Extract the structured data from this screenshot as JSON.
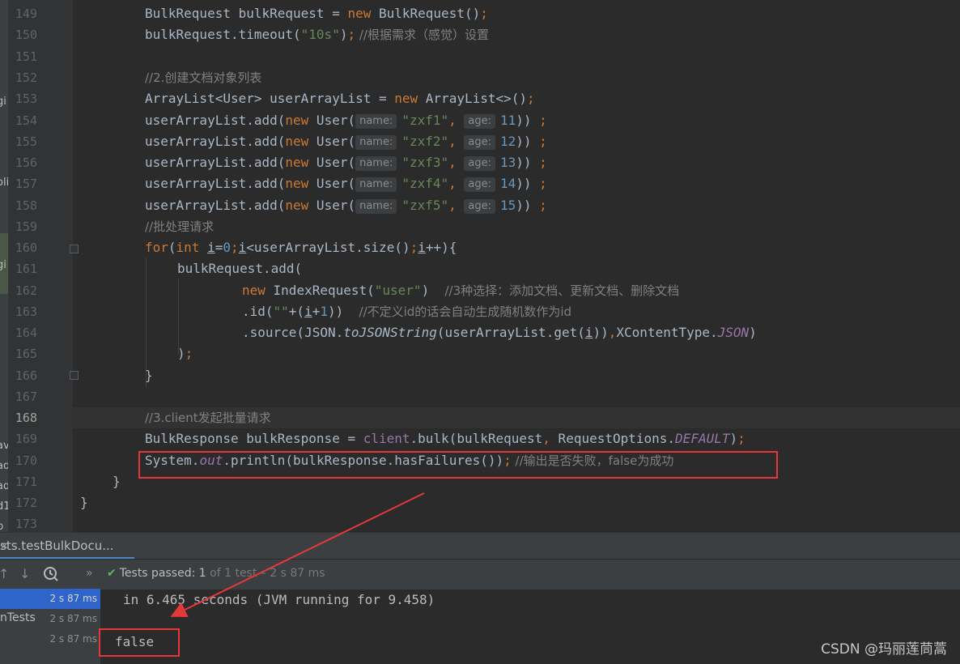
{
  "editor": {
    "line_numbers": [
      "149",
      "150",
      "151",
      "152",
      "153",
      "154",
      "155",
      "156",
      "157",
      "158",
      "159",
      "160",
      "161",
      "162",
      "163",
      "164",
      "165",
      "166",
      "167",
      "168",
      "169",
      "170",
      "171",
      "172",
      "173"
    ],
    "current_line": "168",
    "code": {
      "l149": {
        "t1": "BulkRequest bulkRequest = ",
        "kw": "new",
        "t2": " BulkRequest()",
        "semi": ";"
      },
      "l150": {
        "t1": "bulkRequest.timeout(",
        "str": "\"10s\"",
        "t2": ")",
        "semi": ";",
        "cmt": " //根据需求（感觉）设置"
      },
      "l152": {
        "cmt": "//2.创建文档对象列表"
      },
      "l153": {
        "t1": "ArrayList<User> userArrayList = ",
        "kw": "new",
        "t2": " ArrayList<>()",
        "semi": ";"
      },
      "users": [
        {
          "t1": "userArrayList.add(",
          "kw": "new",
          "t2": " User(",
          "hint_name": "name:",
          "str": "\"zxf1\"",
          "comma": ", ",
          "hint_age": "age:",
          "num": "11",
          "t3": "))",
          "semi": " ;"
        },
        {
          "t1": "userArrayList.add(",
          "kw": "new",
          "t2": " User(",
          "hint_name": "name:",
          "str": "\"zxf2\"",
          "comma": ", ",
          "hint_age": "age:",
          "num": "12",
          "t3": "))",
          "semi": " ;"
        },
        {
          "t1": "userArrayList.add(",
          "kw": "new",
          "t2": " User(",
          "hint_name": "name:",
          "str": "\"zxf3\"",
          "comma": ", ",
          "hint_age": "age:",
          "num": "13",
          "t3": "))",
          "semi": " ;"
        },
        {
          "t1": "userArrayList.add(",
          "kw": "new",
          "t2": " User(",
          "hint_name": "name:",
          "str": "\"zxf4\"",
          "comma": ", ",
          "hint_age": "age:",
          "num": "14",
          "t3": "))",
          "semi": " ;"
        },
        {
          "t1": "userArrayList.add(",
          "kw": "new",
          "t2": " User(",
          "hint_name": "name:",
          "str": "\"zxf5\"",
          "comma": ", ",
          "hint_age": "age:",
          "num": "15",
          "t3": "))",
          "semi": " ;"
        }
      ],
      "l159": {
        "cmt": "//批处理请求"
      },
      "l160": {
        "kw1": "for",
        "p1": "(",
        "kw2": "int",
        "sp": " ",
        "v1": "i",
        "eq": "=",
        "n0": "0",
        "s1": ";",
        "v2": "i",
        "lt": "<userArrayList.size()",
        "s2": ";",
        "v3": "i",
        "inc": "++){"
      },
      "l161": {
        "t1": "bulkRequest.add("
      },
      "l162": {
        "kw": "new",
        "t1": " IndexRequest(",
        "str": "\"user\"",
        "t2": ")  ",
        "cmt": "//3种选择：添加文档、更新文档、删除文档"
      },
      "l163": {
        "t1": ".id(",
        "str": "\"\"",
        "t2": "+(",
        "v": "i",
        "t3": "+",
        "n": "1",
        "t4": "))  ",
        "cmt": "//不定义id的话会自动生成随机数作为id"
      },
      "l164": {
        "t1": ".source(JSON.",
        "it": "toJSONString",
        "t2": "(userArrayList.get(",
        "v": "i",
        "t3": "))",
        "c": ",",
        "t4": "XContentType.",
        "fld": "JSON",
        "t5": ")"
      },
      "l165": {
        "t1": ")",
        "semi": ";"
      },
      "l166": {
        "t1": "}"
      },
      "l168": {
        "cmt": "//3.client发起批量请求"
      },
      "l169": {
        "t1": "BulkResponse bulkResponse = ",
        "fld": "client",
        "t2": ".bulk(bulkRequest",
        "c": ",",
        "t3": " RequestOptions.",
        "fld2": "DEFAULT",
        "t4": ")",
        "semi": ";"
      },
      "l170": {
        "t1": "System.",
        "fld": "out",
        "t2": ".println(bulkResponse.hasFailures())",
        "semi": ";",
        "cmt": " //输出是否失败，false为成功"
      },
      "l171": {
        "t1": "}"
      },
      "l172": {
        "t1": "}"
      }
    }
  },
  "left_strip_fragments": [
    "gi",
    "oli",
    "gi",
    "ava",
    "ad",
    "ad",
    "d1",
    "p"
  ],
  "run_panel": {
    "tab_label": "sts.testBulkDocu...",
    "tab_close": "×",
    "tests_passed_label": "Tests passed:",
    "passed_count": "1",
    "of_total": "of 1 test",
    "duration": "– 2 s 87 ms",
    "tree": [
      {
        "name": "",
        "time": "2 s 87 ms",
        "selected": true
      },
      {
        "name": "nTests",
        "time": "2 s 87 ms",
        "selected": false
      },
      {
        "name": "",
        "time": "2 s 87 ms",
        "selected": false
      }
    ],
    "console_lines": [
      "in 6.465 seconds (JVM running for 9.458)",
      "false"
    ]
  },
  "watermark": "CSDN @玛丽莲茼蒿",
  "colors": {
    "keyword": "#cc7832",
    "string": "#6a8759",
    "number": "#6897bb",
    "comment": "#808080",
    "field": "#9876aa",
    "highlight_box": "#e5383b",
    "selection": "#2f65ca"
  }
}
